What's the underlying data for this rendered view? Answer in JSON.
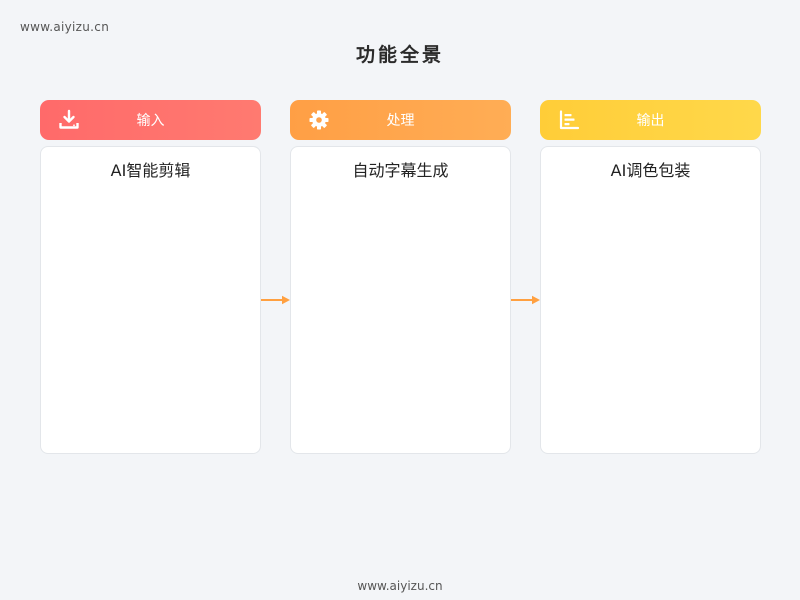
{
  "watermark": {
    "top": "www.aiyizu.cn",
    "bottom": "www.aiyizu.cn"
  },
  "page": {
    "title": "功能全景"
  },
  "colors": {
    "input": "#ff6a6a",
    "process": "#ffa24a",
    "output": "#ffd23f",
    "arrow": "#ffa040"
  },
  "columns": [
    {
      "icon": "download-icon",
      "label": "输入",
      "content": "AI智能剪辑"
    },
    {
      "icon": "gear-icon",
      "label": "处理",
      "content": "自动字幕生成"
    },
    {
      "icon": "chart-icon",
      "label": "输出",
      "content": "AI调色包装"
    }
  ]
}
